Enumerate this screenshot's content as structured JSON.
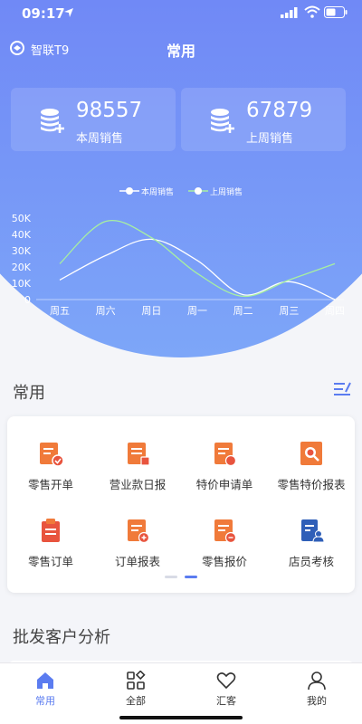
{
  "status": {
    "time": "09:17"
  },
  "header": {
    "brand": "智联T9",
    "title": "常用"
  },
  "stats": [
    {
      "value": "98557",
      "label": "本周销售"
    },
    {
      "value": "67879",
      "label": "上周销售"
    }
  ],
  "chart_data": {
    "type": "line",
    "categories": [
      "周五",
      "周六",
      "周日",
      "周一",
      "周二",
      "周三",
      "周四"
    ],
    "series": [
      {
        "name": "本周销售",
        "values": [
          12000,
          27000,
          37000,
          24000,
          3000,
          11000,
          0
        ],
        "color": "#ffffff"
      },
      {
        "name": "上周销售",
        "values": [
          22000,
          48000,
          38000,
          16000,
          2000,
          12000,
          22000
        ],
        "color": "#a8f0a0"
      }
    ],
    "y_ticks": [
      "0",
      "10K",
      "20K",
      "30K",
      "40K",
      "50K"
    ],
    "ylim": [
      0,
      50000
    ],
    "legend": "top-center"
  },
  "sections": {
    "common": "常用",
    "wholesale": "批发客户分析"
  },
  "grid_items": [
    {
      "label": "零售开单",
      "icon": "retail-order-icon"
    },
    {
      "label": "营业款日报",
      "icon": "daily-report-icon"
    },
    {
      "label": "特价申请单",
      "icon": "special-price-icon"
    },
    {
      "label": "零售特价报表",
      "icon": "search-report-icon"
    },
    {
      "label": "零售订单",
      "icon": "clipboard-icon"
    },
    {
      "label": "订单报表",
      "icon": "order-report-icon"
    },
    {
      "label": "零售报价",
      "icon": "quote-icon"
    },
    {
      "label": "店员考核",
      "icon": "staff-check-icon"
    }
  ],
  "tabs": [
    {
      "label": "常用",
      "icon": "home-icon",
      "active": true
    },
    {
      "label": "全部",
      "icon": "grid-icon"
    },
    {
      "label": "汇客",
      "icon": "heart-icon"
    },
    {
      "label": "我的",
      "icon": "user-icon"
    }
  ],
  "colors": {
    "accent": "#5b7cf0",
    "icon_orange": "#f07a3a",
    "icon_red": "#e8543e"
  }
}
